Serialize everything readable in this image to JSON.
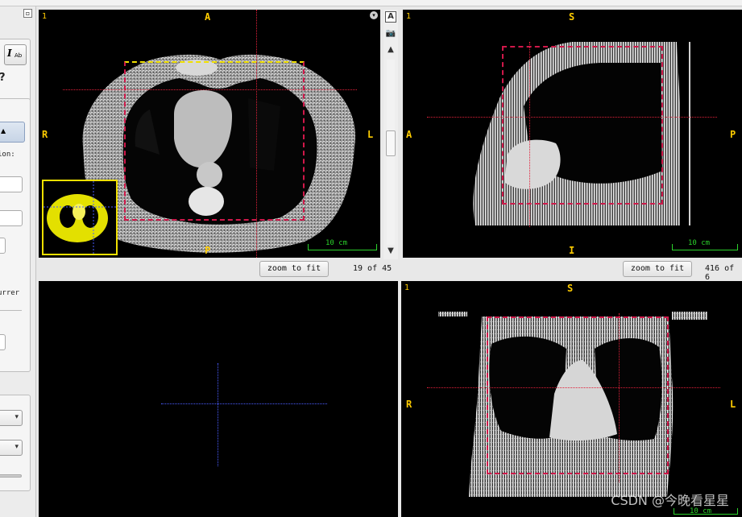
{
  "views": {
    "axial": {
      "index": "1",
      "orient_top": "A",
      "orient_left": "R",
      "orient_right": "L",
      "orient_bottom": "P",
      "scale_label": "10 cm",
      "zoom_label": "zoom to fit",
      "slice_label": "19 of 45"
    },
    "sagittal": {
      "index": "1",
      "orient_top": "S",
      "orient_left": "A",
      "orient_right": "P",
      "orient_bottom": "I",
      "scale_label": "10 cm",
      "zoom_label": "zoom to fit",
      "slice_label": "416 of 6"
    },
    "render3d": {},
    "coronal": {
      "index": "1",
      "orient_top": "S",
      "orient_left": "R",
      "orient_right": "L",
      "scale_label": "10 cm"
    }
  },
  "left_panel": {
    "label_position": "ion:",
    "label_current": "urrer",
    "tool_icon_label": "Ab"
  },
  "watermark": "CSDN @今晚看星星",
  "colors": {
    "crosshair": "#e0203a",
    "crop_box": "#d0184a",
    "overlay_text": "#ffcc00",
    "scale_bar": "#2bd22b",
    "crosshair_3d": "#4a5cff",
    "mini_map": "#e3e000"
  },
  "icons": [
    "restore-icon",
    "text-annotation-icon",
    "camera-icon",
    "scroll-up-icon",
    "scroll-down-icon",
    "dropdown-arrow-icon",
    "help-icon"
  ]
}
